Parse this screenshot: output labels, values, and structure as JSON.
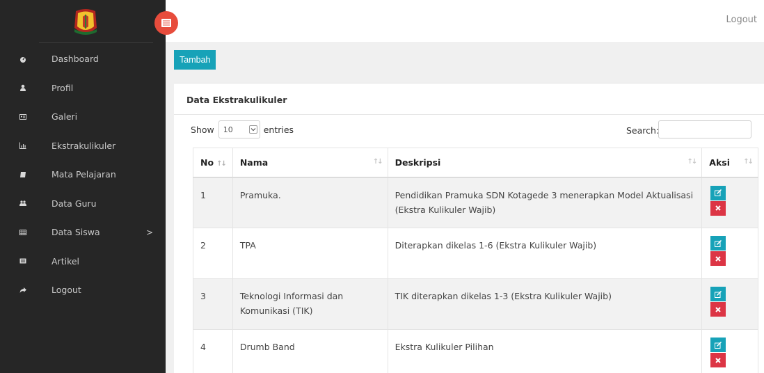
{
  "sidebar": {
    "toggle_icon": "menu-icon",
    "items": [
      {
        "label": "Dashboard",
        "icon": "tachometer-icon"
      },
      {
        "label": "Profil",
        "icon": "user-icon"
      },
      {
        "label": "Galeri",
        "icon": "id-card-icon"
      },
      {
        "label": "Ekstrakulikuler",
        "icon": "bar-chart-icon"
      },
      {
        "label": "Mata Pelajaran",
        "icon": "book-icon"
      },
      {
        "label": "Data Guru",
        "icon": "users-icon"
      },
      {
        "label": "Data Siswa",
        "icon": "table-icon",
        "chevron": ">"
      },
      {
        "label": "Artikel",
        "icon": "newspaper-icon"
      },
      {
        "label": "Logout",
        "icon": "share-icon"
      }
    ]
  },
  "topbar": {
    "logout": "Logout"
  },
  "toolbar": {
    "add_label": "Tambah"
  },
  "card": {
    "title": "Data Ekstrakulikuler"
  },
  "table_controls": {
    "show_label": "Show",
    "page_size": "10",
    "entries_label": "entries",
    "search_label": "Search:",
    "search_value": ""
  },
  "table": {
    "headers": [
      "No",
      "Nama",
      "Deskripsi",
      "Aksi"
    ],
    "rows": [
      {
        "no": "1",
        "nama": "Pramuka.",
        "deskripsi": "Pendidikan Pramuka SDN Kotagede 3 menerapkan Model Aktualisasi (Ekstra Kulikuler Wajib)"
      },
      {
        "no": "2",
        "nama": "TPA",
        "deskripsi": "Diterapkan dikelas 1-6 (Ekstra Kulikuler Wajib)"
      },
      {
        "no": "3",
        "nama": "Teknologi Informasi dan Komunikasi (TIK)",
        "deskripsi": "TIK diterapkan dikelas 1-3 (Ekstra Kulikuler Wajib)"
      },
      {
        "no": "4",
        "nama": "Drumb Band",
        "deskripsi": "Ekstra Kulikuler Pilihan"
      }
    ]
  },
  "colors": {
    "sidebar_bg": "#262626",
    "accent": "#17a2b8",
    "danger": "#dc3545",
    "toggle": "#e74c3c"
  }
}
